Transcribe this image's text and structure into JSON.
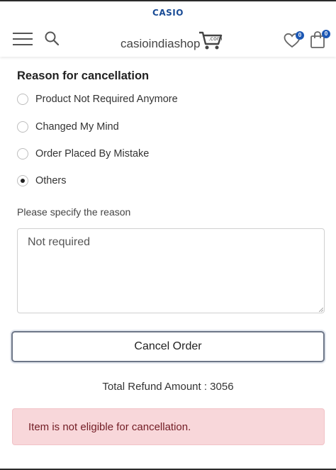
{
  "header": {
    "brand": "CASIO",
    "logo_text": "casioindiashop",
    "logo_suffix": ".com",
    "wishlist_count": "0",
    "cart_count": "0",
    "icons": [
      "menu-icon",
      "search-icon",
      "heart-icon",
      "shopping-bag-icon"
    ]
  },
  "form": {
    "title": "Reason for cancellation",
    "options": [
      {
        "label": "Product Not Required Anymore",
        "checked": false
      },
      {
        "label": "Changed My Mind",
        "checked": false
      },
      {
        "label": "Order Placed By Mistake",
        "checked": false
      },
      {
        "label": "Others",
        "checked": true
      }
    ],
    "specify_label": "Please specify the reason",
    "reason_value": "Not required",
    "cancel_button": "Cancel Order",
    "refund_text": "Total Refund Amount : 3056",
    "alert_text": "Item is not eligible for cancellation."
  },
  "colors": {
    "brand_blue": "#1a4c96",
    "badge_blue": "#1d58b4",
    "alert_bg": "#f8d7da",
    "alert_text": "#721c24"
  }
}
